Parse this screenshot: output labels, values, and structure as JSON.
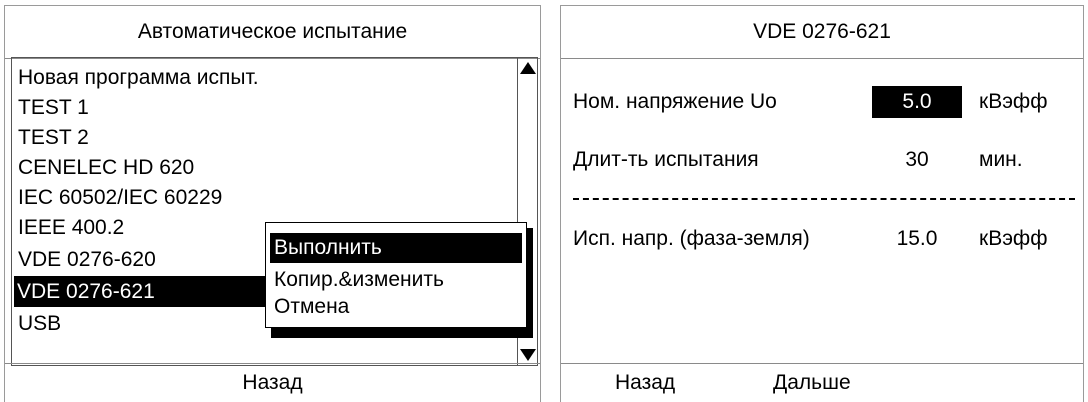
{
  "left_panel": {
    "title": "Автоматическое испытание",
    "items": [
      {
        "label": "Новая программа испыт."
      },
      {
        "label": "TEST 1"
      },
      {
        "label": "TEST 2"
      },
      {
        "label": "CENELEC HD 620"
      },
      {
        "label": "IEC 60502/IEC 60229"
      },
      {
        "label": "IEEE 400.2"
      },
      {
        "label": "VDE 0276-620"
      },
      {
        "label": "VDE 0276-621",
        "selected": true
      },
      {
        "label": "USB"
      }
    ],
    "context_menu": [
      {
        "label": "Выполнить",
        "selected": true
      },
      {
        "label": "Копир.&изменить"
      },
      {
        "label": "Отмена"
      }
    ],
    "back_label": "Назад"
  },
  "right_panel": {
    "title": "VDE 0276-621",
    "rows": [
      {
        "label": "Ном. напряжение Uo",
        "value": "5.0",
        "unit": "кВэфф"
      },
      {
        "label": "Длит-ть испытания",
        "value": "30",
        "unit": "мин."
      },
      {
        "label": "Исп. напр. (фаза-земля)",
        "value": "15.0",
        "unit": "кВэфф"
      }
    ],
    "back_label": "Назад",
    "next_label": "Дальше"
  }
}
